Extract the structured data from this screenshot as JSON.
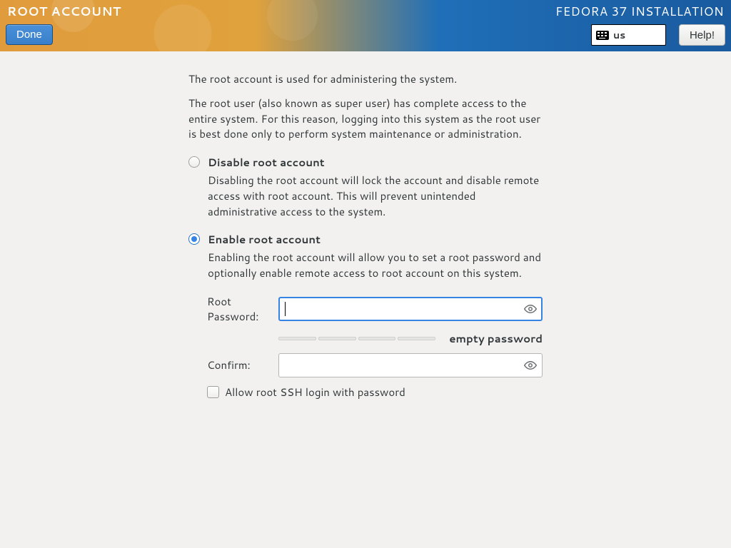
{
  "header": {
    "page_title": "ROOT ACCOUNT",
    "installer_title": "FEDORA 37 INSTALLATION",
    "done_label": "Done",
    "help_label": "Help!",
    "keyboard_layout": "us"
  },
  "intro": {
    "line1": "The root account is used for administering the system.",
    "line2": "The root user (also known as super user) has complete access to the entire system. For this reason, logging into this system as the root user is best done only to perform system maintenance or administration."
  },
  "options": {
    "disable": {
      "label": "Disable root account",
      "desc": "Disabling the root account will lock the account and disable remote access with root account. This will prevent unintended administrative access to the system.",
      "selected": false
    },
    "enable": {
      "label": "Enable root account",
      "desc": "Enabling the root account will allow you to set a root password and optionally enable remote access to root account on this system.",
      "selected": true
    }
  },
  "form": {
    "password_label": "Root Password:",
    "password_value": "",
    "confirm_label": "Confirm:",
    "confirm_value": "",
    "strength_label": "empty password",
    "ssh_checkbox_label": "Allow root SSH login with password",
    "ssh_checked": false
  }
}
